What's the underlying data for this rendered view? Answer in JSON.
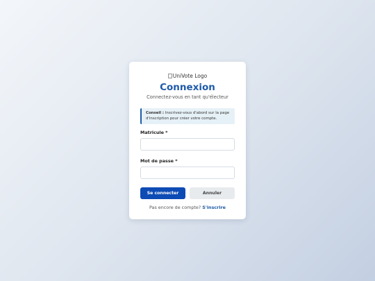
{
  "logo": {
    "alt": "UniVote Logo"
  },
  "login": {
    "title": "Connexion",
    "subtitle": "Connectez-vous en tant qu'électeur",
    "tip": {
      "label": "Conseil :",
      "text": "Inscrivez-vous d'abord sur la page d'inscription pour créer votre compte."
    },
    "fields": {
      "matricule_label": "Matricule *",
      "matricule_value": "",
      "password_label": "Mot de passe *",
      "password_value": ""
    },
    "buttons": {
      "submit": "Se connecter",
      "cancel": "Annuler"
    },
    "signup": {
      "prompt": "Pas encore de compte?",
      "link": "S'inscrire"
    }
  },
  "colors": {
    "accent": "#1e5aa8",
    "primary_button": "#0d4bb5",
    "tip_background": "#e6f1f7"
  }
}
